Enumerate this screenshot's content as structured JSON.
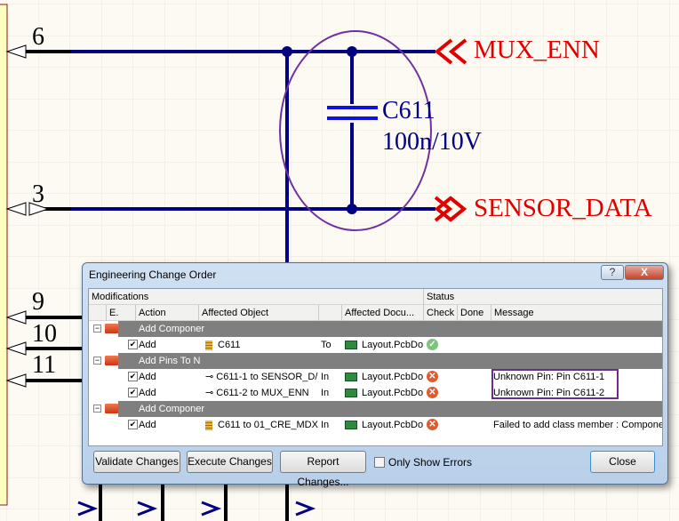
{
  "schematic": {
    "pins": [
      "6",
      "3",
      "9",
      "10",
      "11"
    ],
    "ports": [
      "MUX_ENN",
      "SENSOR_DATA"
    ],
    "component": {
      "designator": "C611",
      "value": "100n/10V"
    },
    "colors": {
      "wire": "#000080",
      "port": "#e00000",
      "highlight": "#7030a0"
    }
  },
  "dialog": {
    "title": "Engineering Change Order",
    "help_label": "?",
    "close_x": "X",
    "section_modifications": "Modifications",
    "section_status": "Status",
    "columns": {
      "enable": "E.",
      "action": "Action",
      "object": "Affected Object",
      "document": "Affected Docu...",
      "check": "Check",
      "done": "Done",
      "message": "Message"
    },
    "groups": [
      "Add Componer",
      "Add Pins To N",
      "Add Componer"
    ],
    "rows": [
      {
        "action": "Add",
        "object": "C611",
        "prep": "To",
        "document": "Layout.PcbDo",
        "check": "ok",
        "message": ""
      },
      {
        "action": "Add",
        "object": "C611-1 to SENSOR_D/",
        "prep": "In",
        "document": "Layout.PcbDo",
        "check": "error",
        "message": "Unknown Pin: Pin C611-1"
      },
      {
        "action": "Add",
        "object": "C611-2 to MUX_ENN",
        "prep": "In",
        "document": "Layout.PcbDo",
        "check": "error",
        "message": "Unknown Pin: Pin C611-2"
      },
      {
        "action": "Add",
        "object": "C611 to 01_CRE_MDX",
        "prep": "In",
        "document": "Layout.PcbDo",
        "check": "error",
        "message": "Failed to add class member : Componen"
      }
    ],
    "buttons": {
      "validate": "Validate Changes",
      "execute": "Execute Changes",
      "report": "Report Changes...",
      "only_errors": "Only Show Errors",
      "close": "Close"
    }
  }
}
